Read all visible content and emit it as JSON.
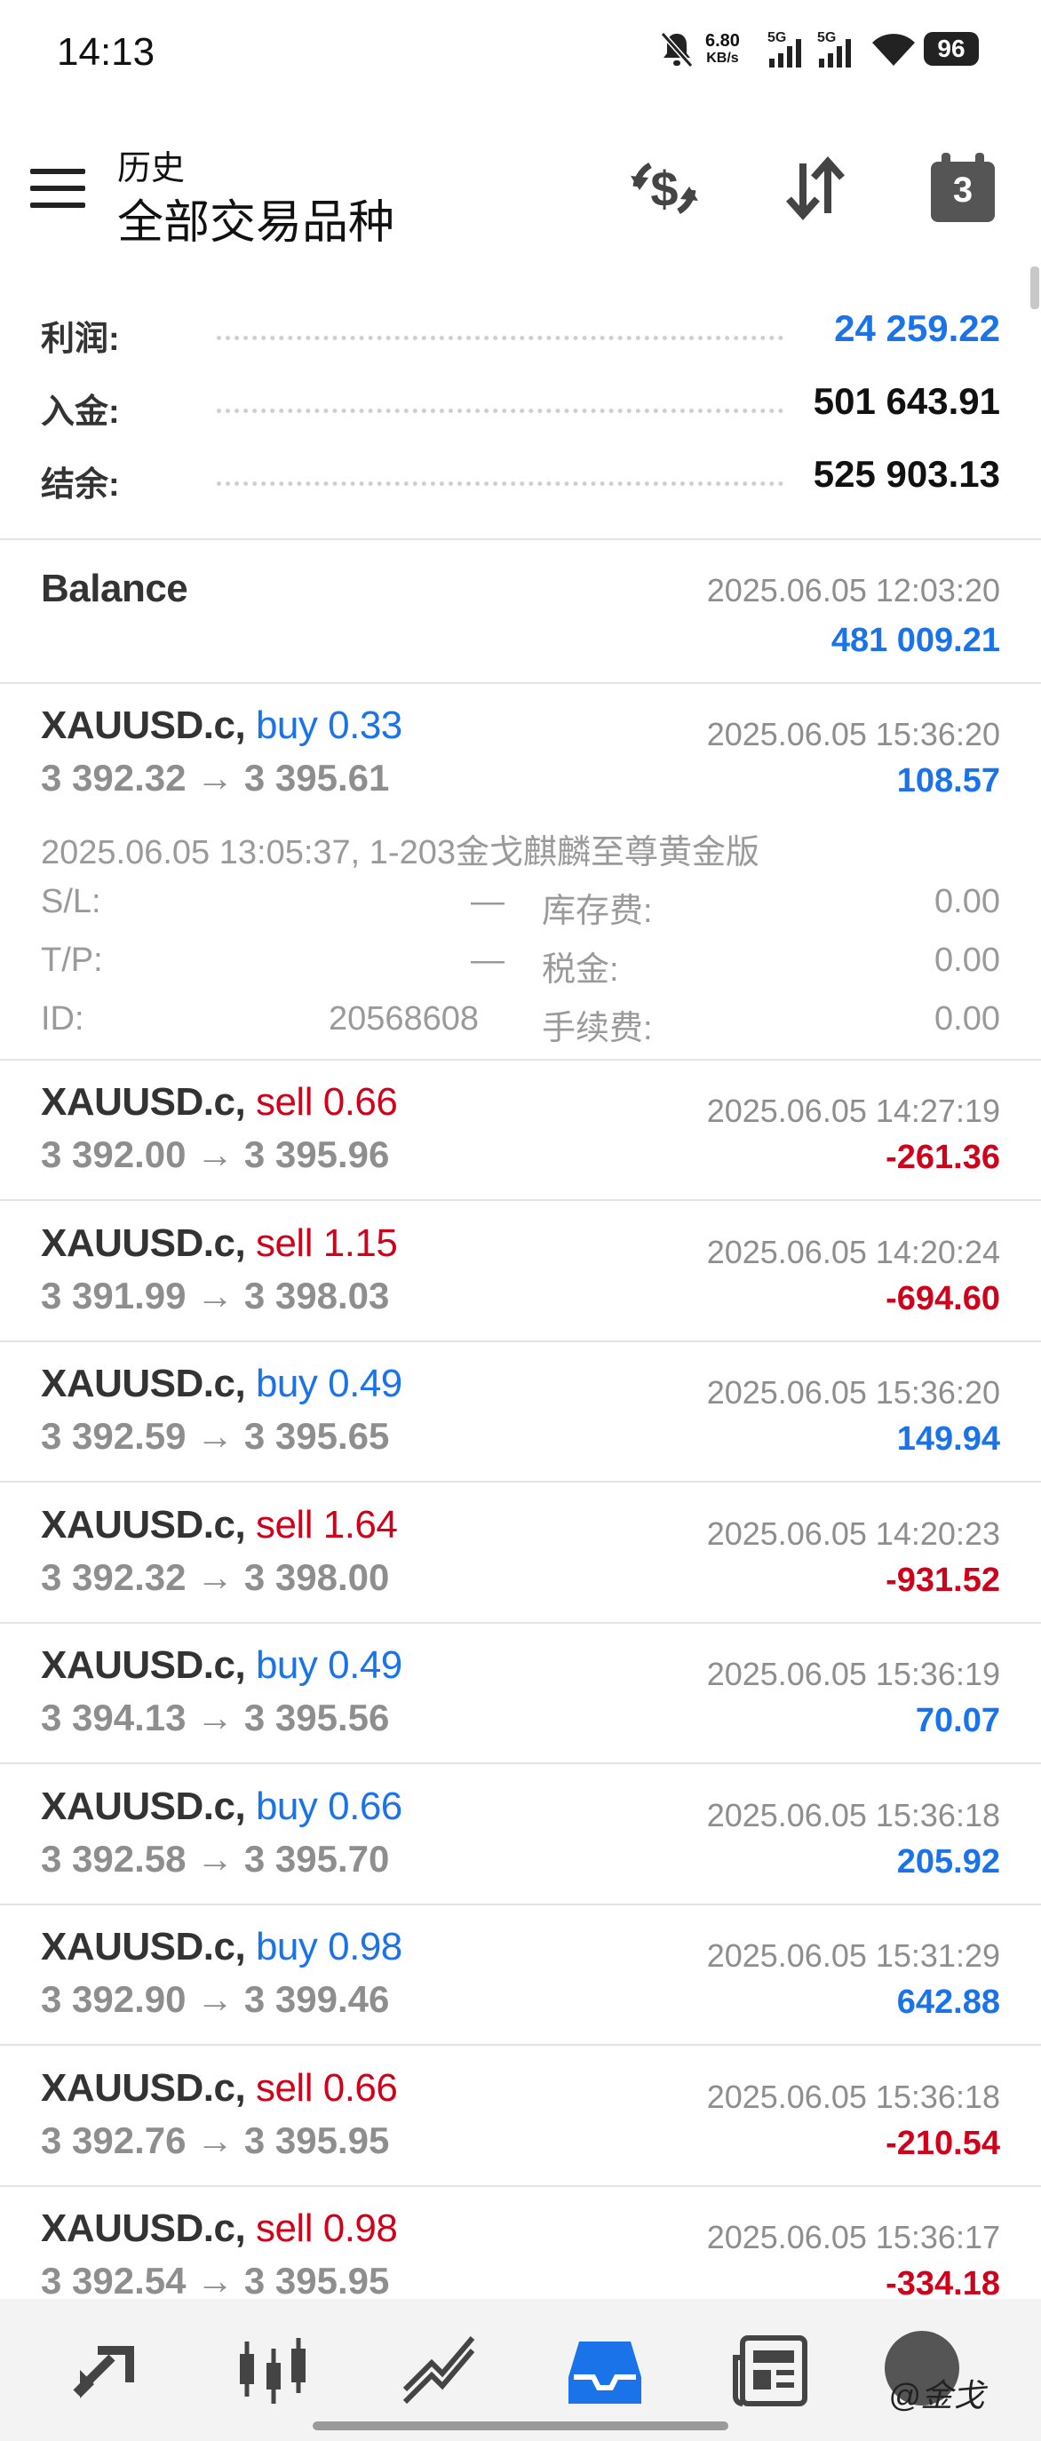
{
  "status_bar": {
    "time": "14:13",
    "net_speed_value": "6.80",
    "net_speed_unit": "KB/s",
    "signal1": "5G",
    "signal2": "5G",
    "battery": "96",
    "icons": [
      "bell-off-icon",
      "signal-5g-icon",
      "signal-5g-icon",
      "wifi-icon",
      "battery-icon"
    ]
  },
  "header": {
    "subtitle": "历史",
    "title": "全部交易品种",
    "calendar_day": "3",
    "icons": [
      "menu-icon",
      "currency-exchange-icon",
      "sort-icon",
      "calendar-icon"
    ]
  },
  "summary": [
    {
      "label": "利润:",
      "value": "24 259.22",
      "color": "#1a73e8"
    },
    {
      "label": "入金:",
      "value": "501 643.91",
      "color": "#111111"
    },
    {
      "label": "结余:",
      "value": "525 903.13",
      "color": "#111111"
    }
  ],
  "balance": {
    "label": "Balance",
    "datetime": "2025.06.05 12:03:20",
    "amount": "481 009.21"
  },
  "expanded_trade": {
    "symbol": "XAUUSD.c,",
    "side": "buy",
    "volume": "0.33",
    "price_open": "3 392.32",
    "arrow": "→",
    "price_close": "3 395.61",
    "datetime": "2025.06.05 15:36:20",
    "profit": "108.57",
    "open_info": "2025.06.05 13:05:37, 1-203金戈麒麟至尊黄金版",
    "sl_label": "S/L:",
    "sl_value": "—",
    "tp_label": "T/P:",
    "tp_value": "—",
    "id_label": "ID:",
    "id_value": "20568608",
    "swap_label": "库存费:",
    "swap_value": "0.00",
    "tax_label": "税金:",
    "tax_value": "0.00",
    "fee_label": "手续费:",
    "fee_value": "0.00"
  },
  "trades": [
    {
      "symbol": "XAUUSD.c,",
      "side": "sell",
      "volume": "0.66",
      "price_open": "3 392.00",
      "arrow": "→",
      "price_close": "3 395.96",
      "datetime": "2025.06.05 14:27:19",
      "profit": "-261.36"
    },
    {
      "symbol": "XAUUSD.c,",
      "side": "sell",
      "volume": "1.15",
      "price_open": "3 391.99",
      "arrow": "→",
      "price_close": "3 398.03",
      "datetime": "2025.06.05 14:20:24",
      "profit": "-694.60"
    },
    {
      "symbol": "XAUUSD.c,",
      "side": "buy",
      "volume": "0.49",
      "price_open": "3 392.59",
      "arrow": "→",
      "price_close": "3 395.65",
      "datetime": "2025.06.05 15:36:20",
      "profit": "149.94"
    },
    {
      "symbol": "XAUUSD.c,",
      "side": "sell",
      "volume": "1.64",
      "price_open": "3 392.32",
      "arrow": "→",
      "price_close": "3 398.00",
      "datetime": "2025.06.05 14:20:23",
      "profit": "-931.52"
    },
    {
      "symbol": "XAUUSD.c,",
      "side": "buy",
      "volume": "0.49",
      "price_open": "3 394.13",
      "arrow": "→",
      "price_close": "3 395.56",
      "datetime": "2025.06.05 15:36:19",
      "profit": "70.07"
    },
    {
      "symbol": "XAUUSD.c,",
      "side": "buy",
      "volume": "0.66",
      "price_open": "3 392.58",
      "arrow": "→",
      "price_close": "3 395.70",
      "datetime": "2025.06.05 15:36:18",
      "profit": "205.92"
    },
    {
      "symbol": "XAUUSD.c,",
      "side": "buy",
      "volume": "0.98",
      "price_open": "3 392.90",
      "arrow": "→",
      "price_close": "3 399.46",
      "datetime": "2025.06.05 15:31:29",
      "profit": "642.88"
    },
    {
      "symbol": "XAUUSD.c,",
      "side": "sell",
      "volume": "0.66",
      "price_open": "3 392.76",
      "arrow": "→",
      "price_close": "3 395.95",
      "datetime": "2025.06.05 15:36:18",
      "profit": "-210.54"
    },
    {
      "symbol": "XAUUSD.c,",
      "side": "sell",
      "volume": "0.98",
      "price_open": "3 392.54",
      "arrow": "→",
      "price_close": "3 395.95",
      "datetime": "2025.06.05 15:36:17",
      "profit": "-334.18"
    }
  ],
  "bottom_nav": {
    "items": [
      "quotes-icon",
      "chart-icon",
      "trade-icon",
      "history-icon",
      "news-icon",
      "account-icon"
    ],
    "active": "history-icon",
    "watermark": "@金戈"
  },
  "colors": {
    "buy": "#1a73e8",
    "sell": "#d0021b",
    "muted": "#8e8e8e"
  }
}
